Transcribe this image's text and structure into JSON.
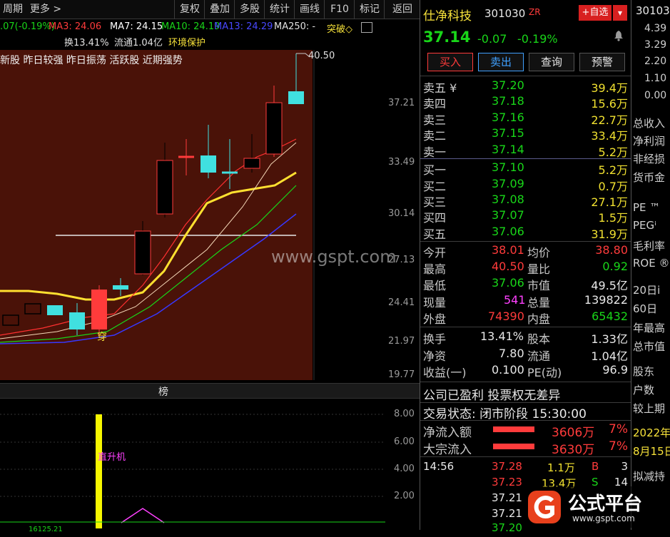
{
  "toolbar": {
    "period": "周期",
    "more": "更多 >",
    "items": [
      "复权",
      "叠加",
      "多股",
      "统计",
      "画线",
      "F10",
      "标记",
      "返回"
    ]
  },
  "ma": {
    "chg": ".07(-0.19%)",
    "turnover": "换13.41%",
    "float": "流通1.04亿",
    "pr": "环境保护",
    "ma3": "MA3: 24.06",
    "ma7": "MA7: 24.15",
    "ma10": "MA10: 24.19",
    "ma13": "MA13: 24.29",
    "ma250": "MA250: -",
    "tag": "突破◇"
  },
  "tags_line": "新股 昨日较强 昨日振荡 活跃股 近期强势",
  "y_ticks": [
    "37.21",
    "33.49",
    "30.14",
    "27.13",
    "24.41",
    "21.97",
    "19.77"
  ],
  "high_label": "40.50",
  "chuan": "穿",
  "watermark": "www.gspt.com",
  "sub": {
    "title": "榜",
    "label": "直升机",
    "y": [
      "8.00",
      "6.00",
      "4.00",
      "2.00"
    ],
    "bottom": "16125.21"
  },
  "colors": {
    "up": "#ff3b3b",
    "down": "#40e0e0",
    "ma3": "#ff3030",
    "ma7": "#ffffff",
    "ma10": "#19d619",
    "ma13": "#3838ff",
    "yellow": "#f7e23a"
  },
  "stock": {
    "name": "仕净科技",
    "code": "301030",
    "flag": "ZR",
    "add": "+自选",
    "dropdown": "▾",
    "price": "37.14",
    "chg": "-0.07",
    "pct": "-0.19%",
    "btn_buy": "买入",
    "btn_sell": "卖出",
    "btn_query": "查询",
    "btn_alert": "预警"
  },
  "asks": [
    {
      "label": "卖五 ¥",
      "p": "37.20",
      "v": "39.4万"
    },
    {
      "label": "卖四",
      "p": "37.18",
      "v": "15.6万"
    },
    {
      "label": "卖三",
      "p": "37.16",
      "v": "22.7万"
    },
    {
      "label": "卖二",
      "p": "37.15",
      "v": "33.4万"
    },
    {
      "label": "卖一",
      "p": "37.14",
      "v": "5.2万"
    }
  ],
  "bids": [
    {
      "label": "买一",
      "p": "37.10",
      "v": "5.2万"
    },
    {
      "label": "买二",
      "p": "37.09",
      "v": "0.7万"
    },
    {
      "label": "买三",
      "p": "37.08",
      "v": "27.1万"
    },
    {
      "label": "买四",
      "p": "37.07",
      "v": "1.5万"
    },
    {
      "label": "买五",
      "p": "37.06",
      "v": "31.9万"
    }
  ],
  "stats": [
    {
      "l1": "今开",
      "v1": "38.01",
      "l2": "均价",
      "v2": "38.80"
    },
    {
      "l1": "最高",
      "v1": "40.50",
      "l2": "量比",
      "v2": "0.92"
    },
    {
      "l1": "最低",
      "v1": "37.06",
      "l2": "市值",
      "v2": "49.5亿"
    },
    {
      "l1": "现量",
      "v1": "541",
      "l2": "总量",
      "v2": "139822"
    },
    {
      "l1": "外盘",
      "v1": "74390",
      "l2": "内盘",
      "v2": "65432"
    }
  ],
  "fund": [
    {
      "l1": "换手",
      "v1": "13.41%",
      "l2": "股本",
      "v2": "1.33亿"
    },
    {
      "l1": "净资",
      "v1": "7.80",
      "l2": "流通",
      "v2": "1.04亿"
    },
    {
      "l1": "收益(一)",
      "v1": "0.100",
      "l2": "PE(动)",
      "v2": "96.9"
    }
  ],
  "notice": "公司已盈利 投票权无差异",
  "status": "交易状态: 闭市阶段 15:30:00",
  "flow": [
    {
      "l": "净流入额",
      "v": "3606万",
      "p": "7%"
    },
    {
      "l": "大宗流入",
      "v": "3630万",
      "p": "7%"
    }
  ],
  "ticks": [
    {
      "t": "14:56",
      "p": "37.28",
      "v": "1.1万",
      "s": "B",
      "n": "3"
    },
    {
      "t": "",
      "p": "37.23",
      "v": "13.4万",
      "s": "S",
      "n": "14"
    },
    {
      "t": "",
      "p": "37.21",
      "v": "",
      "s": "",
      "n": ""
    },
    {
      "t": "",
      "p": "37.21",
      "v": "",
      "s": "",
      "n": ""
    },
    {
      "t": "",
      "p": "37.20",
      "v": "",
      "s": "",
      "n": ""
    }
  ],
  "far": {
    "code": "30103",
    "nums": [
      "4.39",
      "3.29",
      "2.20",
      "1.10",
      "0.00"
    ],
    "labels": [
      "总收入",
      "净利润",
      "非经损",
      "货币金",
      "PE ™",
      "PEGⁱ",
      "毛利率",
      "ROE ®",
      "20日i",
      "60日",
      "年最高",
      "总市值",
      "股东",
      "户数",
      "较上期",
      "2022年",
      "8月15日",
      "拟减持"
    ]
  },
  "logo": {
    "text": "公式平台",
    "sub": "www.gspt.com"
  }
}
